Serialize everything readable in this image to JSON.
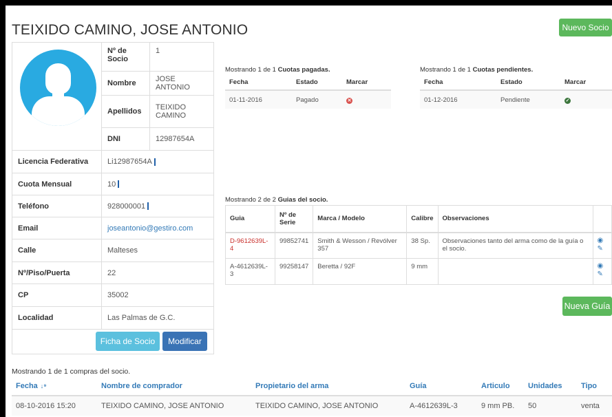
{
  "page": {
    "title": "TEIXIDO CAMINO, JOSE ANTONIO"
  },
  "actions": {
    "nuevo_socio": "Nuevo Socio",
    "nueva_guia": "Nueva Guía",
    "ficha_socio": "Ficha de Socio",
    "modificar": "Modificar"
  },
  "member": {
    "numero_label": "Nº de Socio",
    "numero": "1",
    "nombre_label": "Nombre",
    "nombre": "JOSE ANTONIO",
    "apellidos_label": "Apellidos",
    "apellidos": "TEIXIDO CAMINO",
    "dni_label": "DNI",
    "dni": "12987654A",
    "licencia_label": "Licencia Federativa",
    "licencia": "Li12987654A",
    "cuota_label": "Cuota Mensual",
    "cuota": "10",
    "telefono_label": "Teléfono",
    "telefono": "928000001",
    "email_label": "Email",
    "email": "joseantonio@gestiro.com",
    "calle_label": "Calle",
    "calle": "Malteses",
    "piso_label": "Nº/Piso/Puerta",
    "piso": "22",
    "cp_label": "CP",
    "cp": "35002",
    "localidad_label": "Localidad",
    "localidad": "Las Palmas de G.C."
  },
  "cuotas_pagadas": {
    "caption_prefix": "Mostrando 1 de 1 ",
    "caption_bold": "Cuotas pagadas.",
    "headers": [
      "Fecha",
      "Estado",
      "Marcar"
    ],
    "rows": [
      {
        "fecha": "01-11-2016",
        "estado": "Pagado",
        "icon": "x-circle-icon"
      }
    ]
  },
  "cuotas_pendientes": {
    "caption_prefix": "Mostrando 1 de 1 ",
    "caption_bold": "Cuotas pendientes.",
    "headers": [
      "Fecha",
      "Estado",
      "Marcar"
    ],
    "rows": [
      {
        "fecha": "01-12-2016",
        "estado": "Pendiente",
        "icon": "check-circle-icon"
      }
    ]
  },
  "guias": {
    "caption_prefix": "Mostrando 2 de 2 ",
    "caption_bold": "Guias del socio.",
    "headers": [
      "Guia",
      "Nº de Serie",
      "Marca / Modelo",
      "Calibre",
      "Observaciones"
    ],
    "rows": [
      {
        "guia": "D-9612639L-4",
        "serie": "99852741",
        "marca": "Smith & Wesson / Revólver 357",
        "calibre": "38 Sp.",
        "obs": "Observaciones tanto del arma como de la guía o el socio."
      },
      {
        "guia": "A-4612639L-3",
        "serie": "99258147",
        "marca": "Beretta / 92F",
        "calibre": "9 mm",
        "obs": ""
      }
    ]
  },
  "compras": {
    "caption": "Mostrando 1 de 1 compras del socio.",
    "headers": [
      "Fecha",
      "Nombre de comprador",
      "Propietario del arma",
      "Guía",
      "Articulo",
      "Unidades",
      "Tipo"
    ],
    "rows": [
      {
        "fecha": "08-10-2016 15:20",
        "comprador": "TEIXIDO CAMINO, JOSE ANTONIO",
        "propietario": "TEIXIDO CAMINO, JOSE ANTONIO",
        "guia": "A-4612639L-3",
        "articulo": "9 mm PB.",
        "unidades": "50",
        "tipo": "venta"
      }
    ]
  },
  "colors": {
    "green": "#5cb85c",
    "blue": "#3a73b5",
    "light_blue": "#5bc0de",
    "link": "#337ab7",
    "avatar": "#29aae1"
  }
}
